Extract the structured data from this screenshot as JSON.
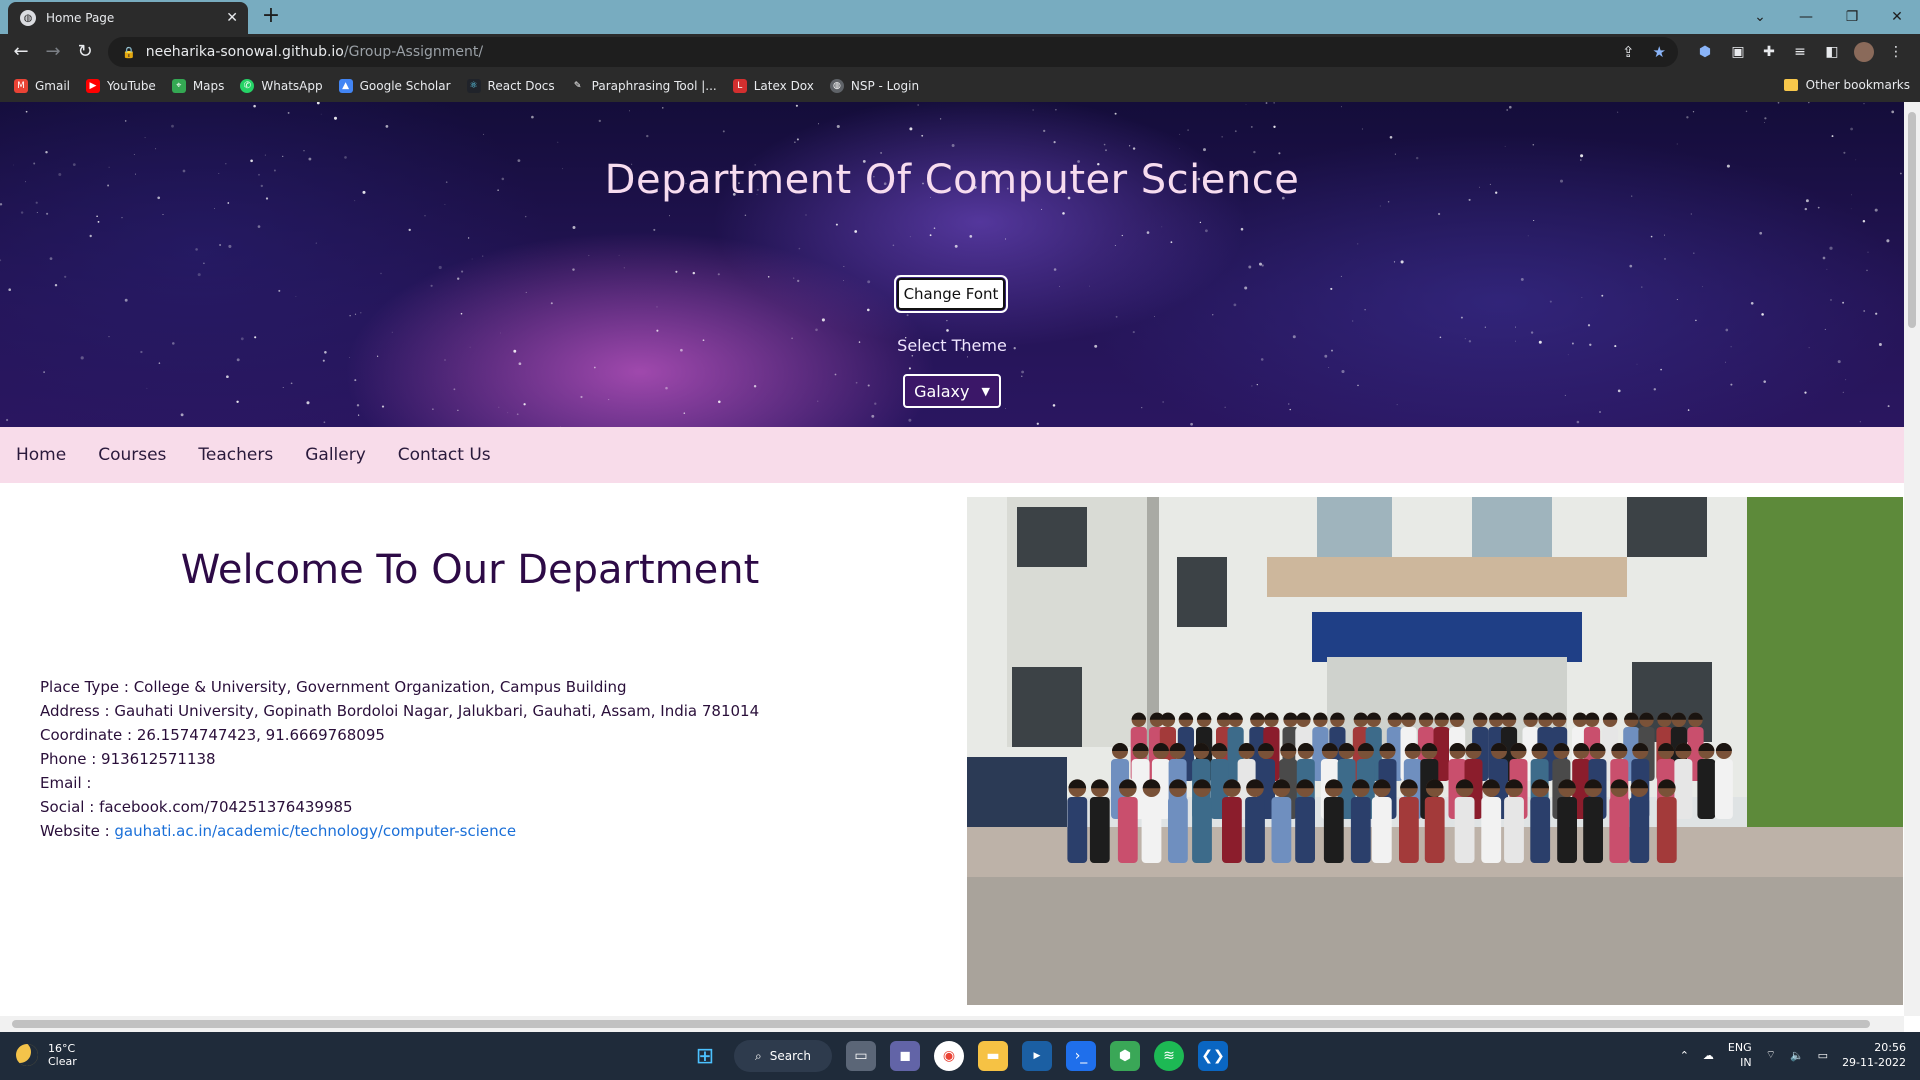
{
  "browser": {
    "tab_title": "Home Page",
    "tab_close": "✕",
    "new_tab": "+",
    "url_host": "neeharika-sonowal.github.io",
    "url_path": "/Group-Assignment/",
    "bookmarks": [
      "Gmail",
      "YouTube",
      "Maps",
      "WhatsApp",
      "Google Scholar",
      "React Docs",
      "Paraphrasing Tool |...",
      "Latex Dox",
      "NSP - Login"
    ],
    "other_bookmarks": "Other bookmarks"
  },
  "header": {
    "title": "Department Of Computer Science",
    "change_font_label": "Change Font",
    "select_theme_label": "Select Theme",
    "theme_value": "Galaxy"
  },
  "nav": [
    "Home",
    "Courses",
    "Teachers",
    "Gallery",
    "Contact Us"
  ],
  "main": {
    "heading": "Welcome To Our Department",
    "place_type": "Place Type : College & University, Government Organization, Campus Building",
    "address": "Address : Gauhati University, Gopinath Bordoloi Nagar, Jalukbari, Gauhati, Assam, India 781014",
    "coordinate": "Coordinate : 26.1574747423, 91.6669768095",
    "phone": "Phone : 913612571138",
    "email": "Email :",
    "social": "Social : facebook.com/704251376439985",
    "website_label": "Website :",
    "website_link": "gauhati.ac.in/academic/technology/computer-science"
  },
  "taskbar": {
    "temperature": "16°C",
    "condition": "Clear",
    "search_label": "Search",
    "language": "ENG",
    "region": "IN",
    "time": "20:56",
    "date": "29-11-2022"
  },
  "colors": {
    "tabstrip": "#78acc0",
    "chrome_dark": "#2b2b2b",
    "navbar": "#f8dcea",
    "heading": "#2d0a46",
    "link": "#1a6fd8"
  }
}
